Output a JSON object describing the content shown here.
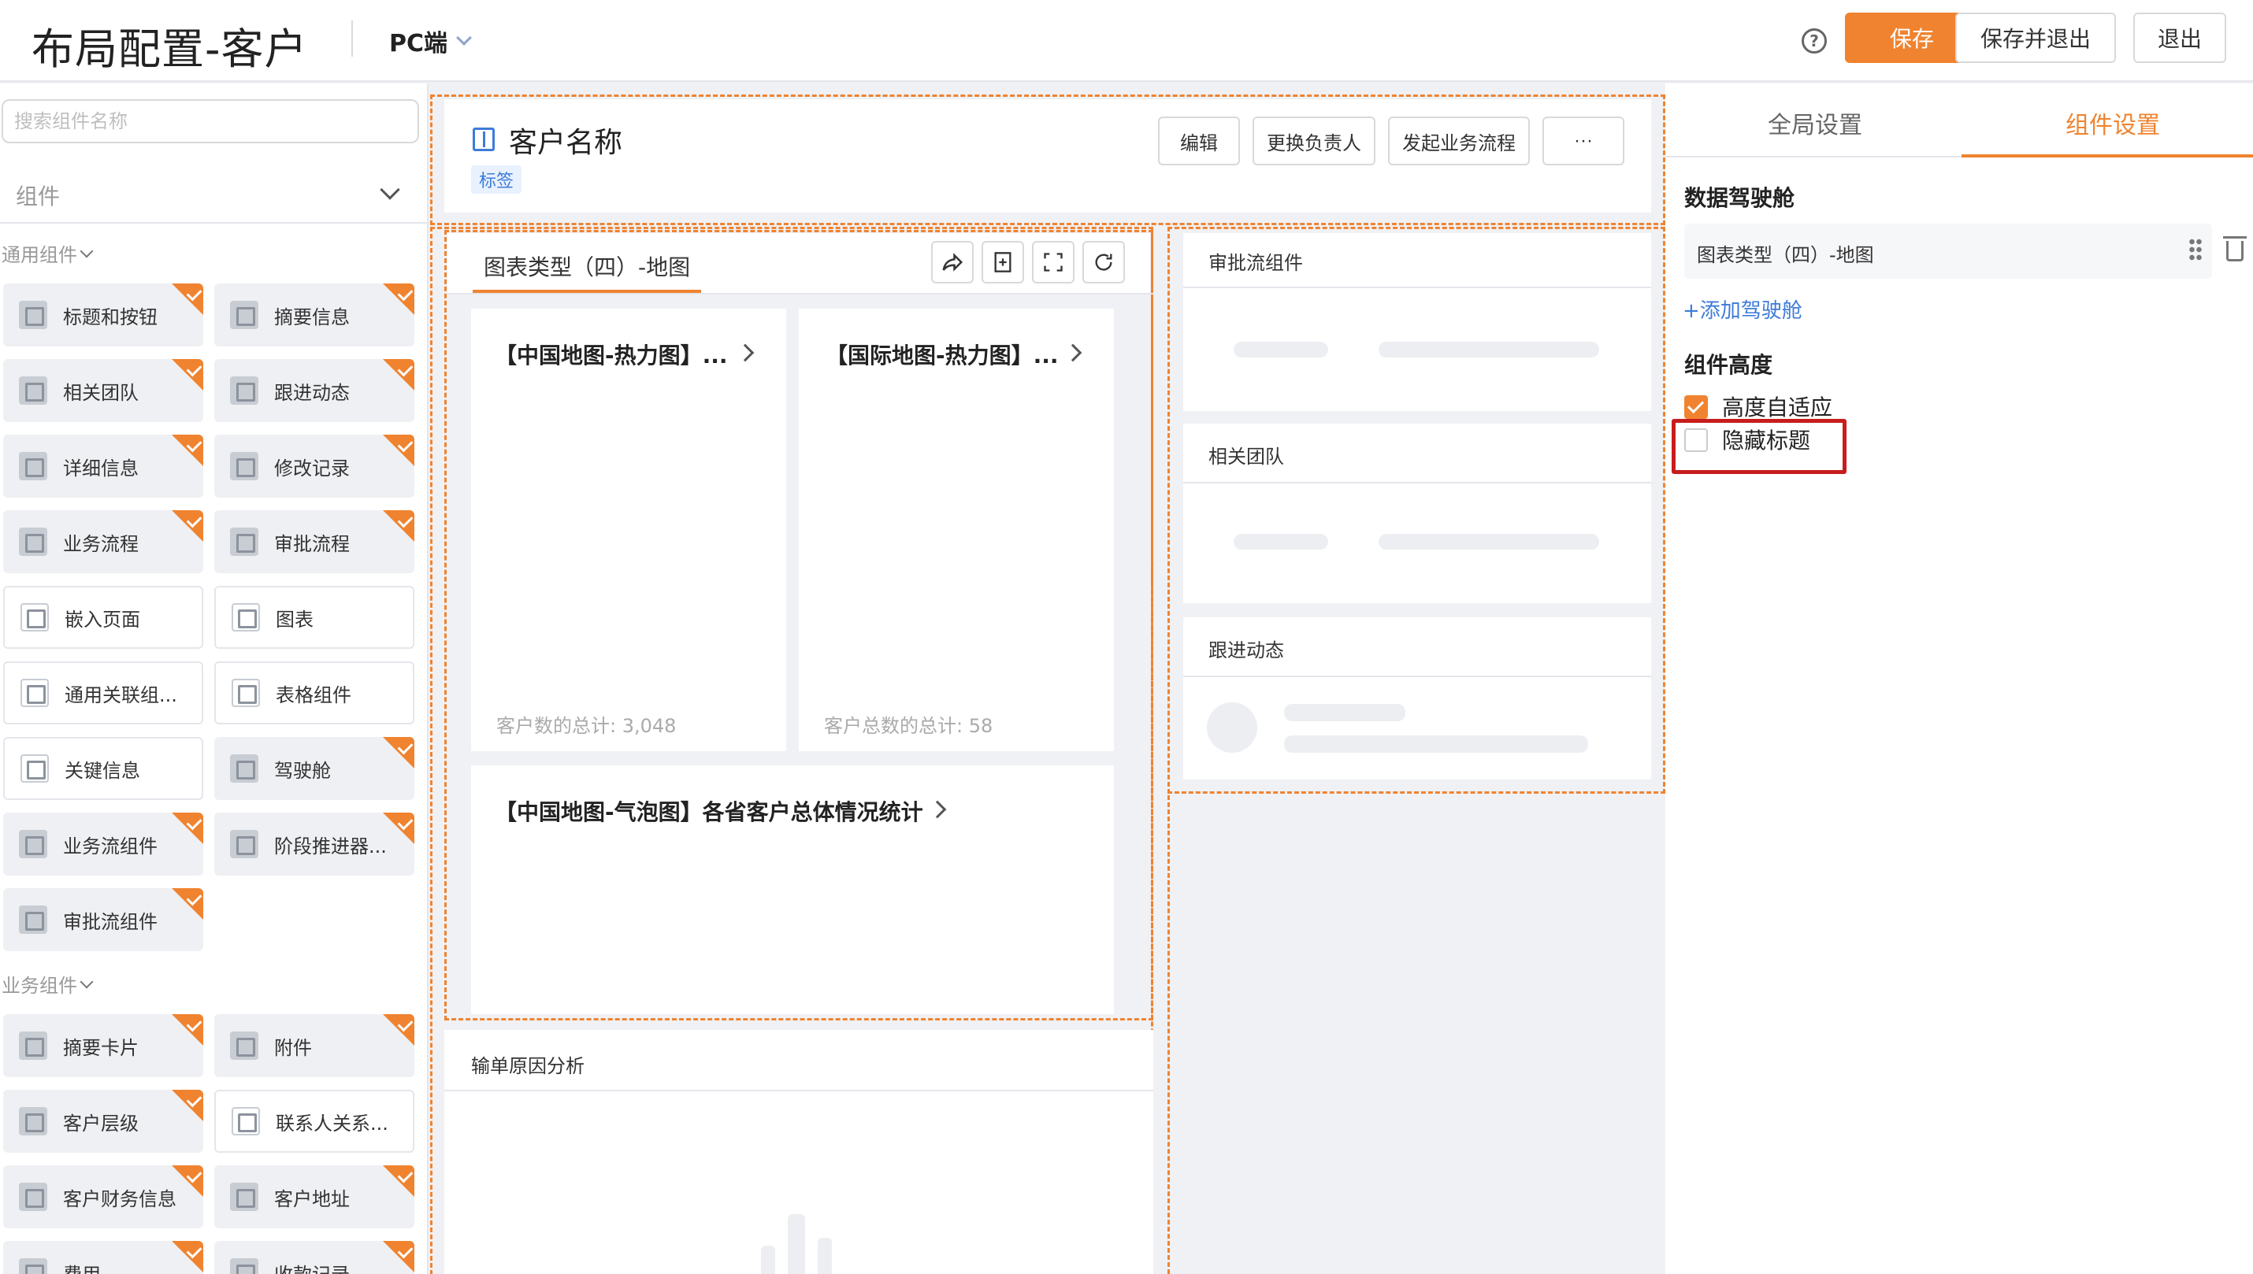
{
  "header": {
    "title": "布局配置-客户",
    "platform": "PC端",
    "help_glyph": "?",
    "save_label": "保存",
    "save_exit_label": "保存并退出",
    "exit_label": "退出",
    "accent_color": "#f0832f"
  },
  "left_panel": {
    "search_placeholder": "搜索组件名称",
    "component_select": "组件",
    "groups": [
      {
        "title": "通用组件",
        "items": [
          {
            "label": "标题和按钮",
            "checked": true
          },
          {
            "label": "摘要信息",
            "checked": true
          },
          {
            "label": "相关团队",
            "checked": true
          },
          {
            "label": "跟进动态",
            "checked": true
          },
          {
            "label": "详细信息",
            "checked": true
          },
          {
            "label": "修改记录",
            "checked": true
          },
          {
            "label": "业务流程",
            "checked": true
          },
          {
            "label": "审批流程",
            "checked": true
          },
          {
            "label": "嵌入页面",
            "checked": false
          },
          {
            "label": "图表",
            "checked": false
          },
          {
            "label": "通用关联组...",
            "checked": false
          },
          {
            "label": "表格组件",
            "checked": false
          },
          {
            "label": "关键信息",
            "checked": false
          },
          {
            "label": "驾驶舱",
            "checked": true
          },
          {
            "label": "业务流组件",
            "checked": true
          },
          {
            "label": "阶段推进器...",
            "checked": true
          },
          {
            "label": "审批流组件",
            "checked": true
          }
        ]
      },
      {
        "title": "业务组件",
        "items": [
          {
            "label": "摘要卡片",
            "checked": true
          },
          {
            "label": "附件",
            "checked": true
          },
          {
            "label": "客户层级",
            "checked": true
          },
          {
            "label": "联系人关系...",
            "checked": false
          },
          {
            "label": "客户财务信息",
            "checked": true
          },
          {
            "label": "客户地址",
            "checked": true
          },
          {
            "label": "费用",
            "checked": true
          },
          {
            "label": "收款记录",
            "checked": true
          }
        ]
      }
    ]
  },
  "canvas": {
    "customer_title": "客户名称",
    "tag": "标签",
    "buttons": [
      "编辑",
      "更换负责人",
      "发起业务流程",
      "···"
    ],
    "chart_tab": "图表类型（四）-地图",
    "chart_cards": [
      {
        "title": "【中国地图-热力图】...",
        "stat": "客户数的总计: 3,048"
      },
      {
        "title": "【国际地图-热力图】...",
        "stat": "客户总数的总计: 58"
      },
      {
        "title": "【中国地图-气泡图】各省客户总体情况统计",
        "stat": ""
      }
    ],
    "loss_analysis_title": "输单原因分析",
    "side_sections": [
      "审批流组件",
      "相关团队",
      "跟进动态"
    ]
  },
  "right_panel": {
    "tabs": [
      "全局设置",
      "组件设置"
    ],
    "active_tab": 1,
    "cockpit_section": "数据驾驶舱",
    "cockpit_item": "图表类型（四）-地图",
    "add_cockpit": "+添加驾驶舱",
    "height_section": "组件高度",
    "auto_height_label": "高度自适应",
    "auto_height_checked": true,
    "hide_title_label": "隐藏标题",
    "hide_title_checked": false
  }
}
